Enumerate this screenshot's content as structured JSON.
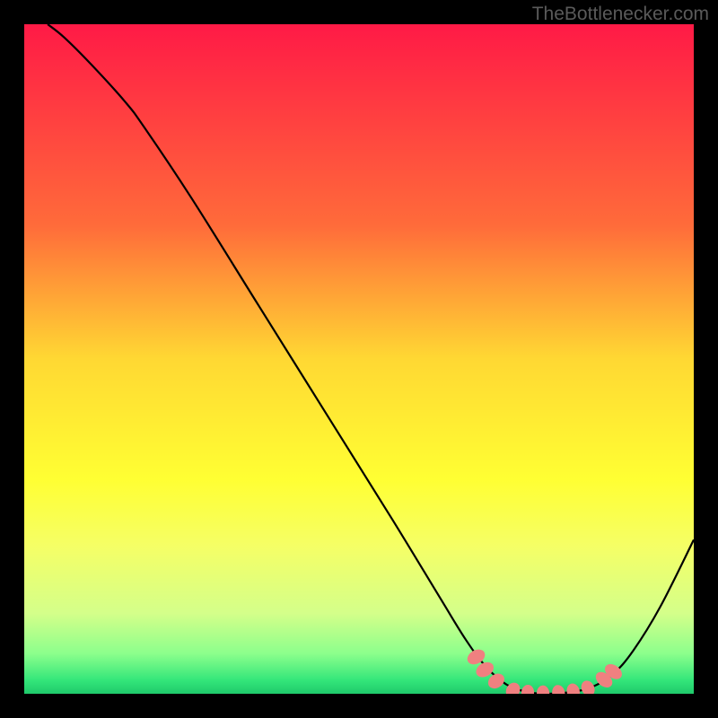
{
  "watermark": "TheBottlenecker.com",
  "chart_data": {
    "type": "line",
    "title": "",
    "xlabel": "",
    "ylabel": "",
    "xlim": [
      0,
      100
    ],
    "ylim": [
      0,
      100
    ],
    "gradient_stops": [
      {
        "offset": 0,
        "color": "#ff1a46"
      },
      {
        "offset": 30,
        "color": "#ff6b3a"
      },
      {
        "offset": 50,
        "color": "#ffd833"
      },
      {
        "offset": 68,
        "color": "#ffff33"
      },
      {
        "offset": 78,
        "color": "#f5ff66"
      },
      {
        "offset": 88,
        "color": "#d4ff8a"
      },
      {
        "offset": 94,
        "color": "#8cff8c"
      },
      {
        "offset": 98,
        "color": "#33e67a"
      },
      {
        "offset": 100,
        "color": "#1fc96b"
      }
    ],
    "series": [
      {
        "name": "curve",
        "type": "line",
        "color": "#000000",
        "points": [
          {
            "x": 3.5,
            "y": 100
          },
          {
            "x": 6,
            "y": 98
          },
          {
            "x": 10,
            "y": 94
          },
          {
            "x": 15,
            "y": 88.5
          },
          {
            "x": 18,
            "y": 84.5
          },
          {
            "x": 25,
            "y": 74
          },
          {
            "x": 35,
            "y": 58
          },
          {
            "x": 45,
            "y": 42
          },
          {
            "x": 55,
            "y": 26
          },
          {
            "x": 62,
            "y": 14.5
          },
          {
            "x": 66,
            "y": 8
          },
          {
            "x": 69,
            "y": 4
          },
          {
            "x": 72,
            "y": 1.4
          },
          {
            "x": 75,
            "y": 0.3
          },
          {
            "x": 78,
            "y": 0
          },
          {
            "x": 82,
            "y": 0.3
          },
          {
            "x": 85,
            "y": 1.1
          },
          {
            "x": 88,
            "y": 3
          },
          {
            "x": 91,
            "y": 6.5
          },
          {
            "x": 95,
            "y": 13
          },
          {
            "x": 100,
            "y": 23
          }
        ]
      },
      {
        "name": "markers",
        "type": "scatter",
        "color": "#f08080",
        "points": [
          {
            "x": 67.5,
            "y": 5.5,
            "w": 2.0,
            "h": 2.8,
            "rot": 60
          },
          {
            "x": 68.8,
            "y": 3.6,
            "w": 2.0,
            "h": 2.8,
            "rot": 60
          },
          {
            "x": 70.5,
            "y": 1.9,
            "w": 2.0,
            "h": 2.6,
            "rot": 55
          },
          {
            "x": 73.0,
            "y": 0.5,
            "w": 2.0,
            "h": 2.4,
            "rot": 30
          },
          {
            "x": 75.2,
            "y": 0.15,
            "w": 1.9,
            "h": 2.4,
            "rot": 5
          },
          {
            "x": 77.5,
            "y": 0.05,
            "w": 1.9,
            "h": 2.4,
            "rot": -5
          },
          {
            "x": 79.8,
            "y": 0.12,
            "w": 1.9,
            "h": 2.4,
            "rot": -10
          },
          {
            "x": 82.0,
            "y": 0.35,
            "w": 1.9,
            "h": 2.4,
            "rot": -15
          },
          {
            "x": 84.2,
            "y": 0.8,
            "w": 1.9,
            "h": 2.4,
            "rot": -25
          },
          {
            "x": 86.6,
            "y": 2.1,
            "w": 1.9,
            "h": 2.8,
            "rot": -50
          },
          {
            "x": 88.0,
            "y": 3.3,
            "w": 1.9,
            "h": 2.8,
            "rot": -55
          }
        ]
      }
    ]
  }
}
